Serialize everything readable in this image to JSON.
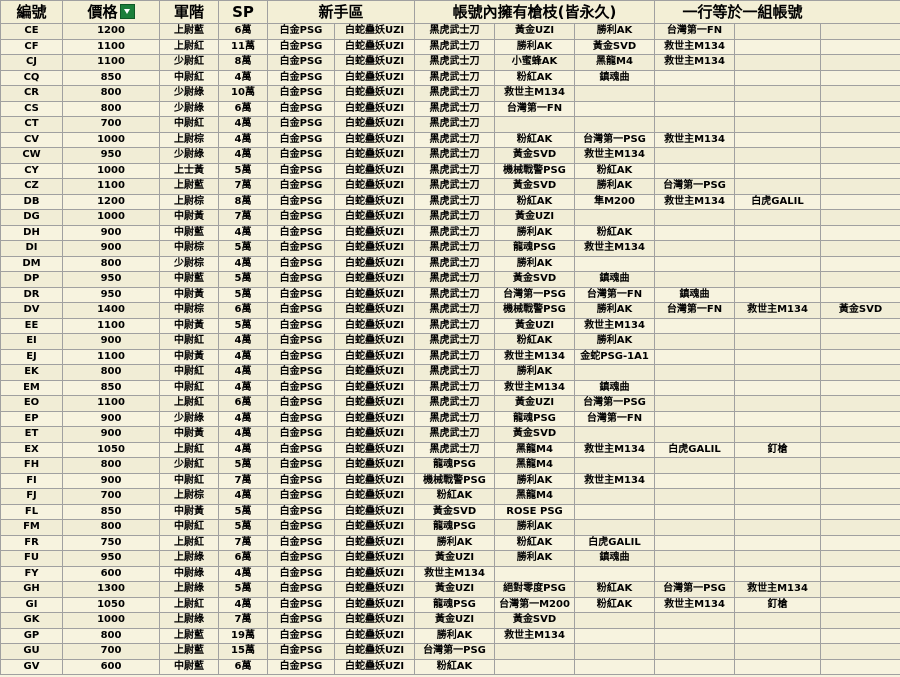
{
  "headers": {
    "code": "編號",
    "price": "價格",
    "rank": "軍階",
    "sp": "SP",
    "newbie": "新手區",
    "guns": "帳號內擁有槍枝(皆永久)",
    "note": "一行等於一組帳號"
  },
  "rows": [
    {
      "code": "CE",
      "price": "1200",
      "rank": "上尉藍",
      "sp": "6萬",
      "newbie": [
        "白金PSG",
        "白蛇蠱妖UZI"
      ],
      "guns": [
        "黑虎武士刀",
        "黃金UZI",
        "勝利AK",
        "台灣第一FN",
        "",
        "",
        ""
      ]
    },
    {
      "code": "CF",
      "price": "1100",
      "rank": "上尉紅",
      "sp": "11萬",
      "newbie": [
        "白金PSG",
        "白蛇蠱妖UZI"
      ],
      "guns": [
        "黑虎武士刀",
        "勝利AK",
        "黃金SVD",
        "救世主M134",
        "",
        "",
        ""
      ]
    },
    {
      "code": "CJ",
      "price": "1100",
      "rank": "少尉紅",
      "sp": "8萬",
      "newbie": [
        "白金PSG",
        "白蛇蠱妖UZI"
      ],
      "guns": [
        "黑虎武士刀",
        "小蜜蜂AK",
        "黑龍M4",
        "救世主M134",
        "",
        "",
        ""
      ]
    },
    {
      "code": "CQ",
      "price": "850",
      "rank": "中尉紅",
      "sp": "4萬",
      "newbie": [
        "白金PSG",
        "白蛇蠱妖UZI"
      ],
      "guns": [
        "黑虎武士刀",
        "粉紅AK",
        "鎮魂曲",
        "",
        "",
        "",
        ""
      ]
    },
    {
      "code": "CR",
      "price": "800",
      "rank": "少尉綠",
      "sp": "10萬",
      "newbie": [
        "白金PSG",
        "白蛇蠱妖UZI"
      ],
      "guns": [
        "黑虎武士刀",
        "救世主M134",
        "",
        "",
        "",
        "",
        ""
      ]
    },
    {
      "code": "CS",
      "price": "800",
      "rank": "少尉綠",
      "sp": "6萬",
      "newbie": [
        "白金PSG",
        "白蛇蠱妖UZI"
      ],
      "guns": [
        "黑虎武士刀",
        "台灣第一FN",
        "",
        "",
        "",
        "",
        ""
      ]
    },
    {
      "code": "CT",
      "price": "700",
      "rank": "中尉紅",
      "sp": "4萬",
      "newbie": [
        "白金PSG",
        "白蛇蠱妖UZI"
      ],
      "guns": [
        "黑虎武士刀",
        "",
        "",
        "",
        "",
        "",
        ""
      ]
    },
    {
      "code": "CV",
      "price": "1000",
      "rank": "上尉棕",
      "sp": "4萬",
      "newbie": [
        "白金PSG",
        "白蛇蠱妖UZI"
      ],
      "guns": [
        "黑虎武士刀",
        "粉紅AK",
        "台灣第一PSG",
        "救世主M134",
        "",
        "",
        ""
      ]
    },
    {
      "code": "CW",
      "price": "950",
      "rank": "少尉綠",
      "sp": "4萬",
      "newbie": [
        "白金PSG",
        "白蛇蠱妖UZI"
      ],
      "guns": [
        "黑虎武士刀",
        "黃金SVD",
        "救世主M134",
        "",
        "",
        "",
        ""
      ]
    },
    {
      "code": "CY",
      "price": "1000",
      "rank": "上士黃",
      "sp": "5萬",
      "newbie": [
        "白金PSG",
        "白蛇蠱妖UZI"
      ],
      "guns": [
        "黑虎武士刀",
        "機械戰警PSG",
        "粉紅AK",
        "",
        "",
        "",
        ""
      ]
    },
    {
      "code": "CZ",
      "price": "1100",
      "rank": "上尉藍",
      "sp": "7萬",
      "newbie": [
        "白金PSG",
        "白蛇蠱妖UZI"
      ],
      "guns": [
        "黑虎武士刀",
        "黃金SVD",
        "勝利AK",
        "台灣第一PSG",
        "",
        "",
        ""
      ]
    },
    {
      "code": "DB",
      "price": "1200",
      "rank": "上尉棕",
      "sp": "8萬",
      "newbie": [
        "白金PSG",
        "白蛇蠱妖UZI"
      ],
      "guns": [
        "黑虎武士刀",
        "粉紅AK",
        "隼M200",
        "救世主M134",
        "白虎GALIL",
        "",
        ""
      ]
    },
    {
      "code": "DG",
      "price": "1000",
      "rank": "中尉黃",
      "sp": "7萬",
      "newbie": [
        "白金PSG",
        "白蛇蠱妖UZI"
      ],
      "guns": [
        "黑虎武士刀",
        "黃金UZI",
        "",
        "",
        "",
        "",
        ""
      ]
    },
    {
      "code": "DH",
      "price": "900",
      "rank": "中尉藍",
      "sp": "4萬",
      "newbie": [
        "白金PSG",
        "白蛇蠱妖UZI"
      ],
      "guns": [
        "黑虎武士刀",
        "勝利AK",
        "粉紅AK",
        "",
        "",
        "",
        ""
      ]
    },
    {
      "code": "DI",
      "price": "900",
      "rank": "中尉棕",
      "sp": "5萬",
      "newbie": [
        "白金PSG",
        "白蛇蠱妖UZI"
      ],
      "guns": [
        "黑虎武士刀",
        "龍魂PSG",
        "救世主M134",
        "",
        "",
        "",
        ""
      ]
    },
    {
      "code": "DM",
      "price": "800",
      "rank": "少尉棕",
      "sp": "4萬",
      "newbie": [
        "白金PSG",
        "白蛇蠱妖UZI"
      ],
      "guns": [
        "黑虎武士刀",
        "勝利AK",
        "",
        "",
        "",
        "",
        ""
      ]
    },
    {
      "code": "DP",
      "price": "950",
      "rank": "中尉藍",
      "sp": "5萬",
      "newbie": [
        "白金PSG",
        "白蛇蠱妖UZI"
      ],
      "guns": [
        "黑虎武士刀",
        "黃金SVD",
        "鎮魂曲",
        "",
        "",
        "",
        ""
      ]
    },
    {
      "code": "DR",
      "price": "950",
      "rank": "中尉黃",
      "sp": "5萬",
      "newbie": [
        "白金PSG",
        "白蛇蠱妖UZI"
      ],
      "guns": [
        "黑虎武士刀",
        "台灣第一PSG",
        "台灣第一FN",
        "鎮魂曲",
        "",
        "",
        ""
      ]
    },
    {
      "code": "DV",
      "price": "1400",
      "rank": "中尉棕",
      "sp": "6萬",
      "newbie": [
        "白金PSG",
        "白蛇蠱妖UZI"
      ],
      "guns": [
        "黑虎武士刀",
        "機械戰警PSG",
        "勝利AK",
        "台灣第一FN",
        "救世主M134",
        "黃金SVD",
        ""
      ]
    },
    {
      "code": "EE",
      "price": "1100",
      "rank": "中尉黃",
      "sp": "5萬",
      "newbie": [
        "白金PSG",
        "白蛇蠱妖UZI"
      ],
      "guns": [
        "黑虎武士刀",
        "黃金UZI",
        "救世主M134",
        "",
        "",
        "",
        ""
      ]
    },
    {
      "code": "EI",
      "price": "900",
      "rank": "中尉紅",
      "sp": "4萬",
      "newbie": [
        "白金PSG",
        "白蛇蠱妖UZI"
      ],
      "guns": [
        "黑虎武士刀",
        "粉紅AK",
        "勝利AK",
        "",
        "",
        "",
        ""
      ]
    },
    {
      "code": "EJ",
      "price": "1100",
      "rank": "中尉黃",
      "sp": "4萬",
      "newbie": [
        "白金PSG",
        "白蛇蠱妖UZI"
      ],
      "guns": [
        "黑虎武士刀",
        "救世主M134",
        "金蛇PSG-1A1",
        "",
        "",
        "",
        ""
      ]
    },
    {
      "code": "EK",
      "price": "800",
      "rank": "中尉紅",
      "sp": "4萬",
      "newbie": [
        "白金PSG",
        "白蛇蠱妖UZI"
      ],
      "guns": [
        "黑虎武士刀",
        "勝利AK",
        "",
        "",
        "",
        "",
        ""
      ]
    },
    {
      "code": "EM",
      "price": "850",
      "rank": "中尉紅",
      "sp": "4萬",
      "newbie": [
        "白金PSG",
        "白蛇蠱妖UZI"
      ],
      "guns": [
        "黑虎武士刀",
        "救世主M134",
        "鎮魂曲",
        "",
        "",
        "",
        ""
      ]
    },
    {
      "code": "EO",
      "price": "1100",
      "rank": "上尉紅",
      "sp": "6萬",
      "newbie": [
        "白金PSG",
        "白蛇蠱妖UZI"
      ],
      "guns": [
        "黑虎武士刀",
        "黃金UZI",
        "台灣第一PSG",
        "",
        "",
        "",
        ""
      ]
    },
    {
      "code": "EP",
      "price": "900",
      "rank": "少尉綠",
      "sp": "4萬",
      "newbie": [
        "白金PSG",
        "白蛇蠱妖UZI"
      ],
      "guns": [
        "黑虎武士刀",
        "龍魂PSG",
        "台灣第一FN",
        "",
        "",
        "",
        ""
      ]
    },
    {
      "code": "ET",
      "price": "900",
      "rank": "中尉黃",
      "sp": "4萬",
      "newbie": [
        "白金PSG",
        "白蛇蠱妖UZI"
      ],
      "guns": [
        "黑虎武士刀",
        "黃金SVD",
        "",
        "",
        "",
        "",
        ""
      ]
    },
    {
      "code": "EX",
      "price": "1050",
      "rank": "上尉紅",
      "sp": "4萬",
      "newbie": [
        "白金PSG",
        "白蛇蠱妖UZI"
      ],
      "guns": [
        "黑虎武士刀",
        "黑龍M4",
        "救世主M134",
        "白虎GALIL",
        "釘槍",
        "",
        ""
      ]
    },
    {
      "code": "FH",
      "price": "800",
      "rank": "少尉紅",
      "sp": "5萬",
      "newbie": [
        "白金PSG",
        "白蛇蠱妖UZI"
      ],
      "guns": [
        "龍魂PSG",
        "黑龍M4",
        "",
        "",
        "",
        "",
        ""
      ]
    },
    {
      "code": "FI",
      "price": "900",
      "rank": "中尉紅",
      "sp": "7萬",
      "newbie": [
        "白金PSG",
        "白蛇蠱妖UZI"
      ],
      "guns": [
        "機械戰警PSG",
        "勝利AK",
        "救世主M134",
        "",
        "",
        "",
        ""
      ]
    },
    {
      "code": "FJ",
      "price": "700",
      "rank": "上尉棕",
      "sp": "4萬",
      "newbie": [
        "白金PSG",
        "白蛇蠱妖UZI"
      ],
      "guns": [
        "粉紅AK",
        "黑龍M4",
        "",
        "",
        "",
        "",
        ""
      ]
    },
    {
      "code": "FL",
      "price": "850",
      "rank": "中尉黃",
      "sp": "5萬",
      "newbie": [
        "白金PSG",
        "白蛇蠱妖UZI"
      ],
      "guns": [
        "黃金SVD",
        "ROSE PSG",
        "",
        "",
        "",
        "",
        ""
      ]
    },
    {
      "code": "FM",
      "price": "800",
      "rank": "中尉紅",
      "sp": "5萬",
      "newbie": [
        "白金PSG",
        "白蛇蠱妖UZI"
      ],
      "guns": [
        "龍魂PSG",
        "勝利AK",
        "",
        "",
        "",
        "",
        ""
      ]
    },
    {
      "code": "FR",
      "price": "750",
      "rank": "上尉紅",
      "sp": "7萬",
      "newbie": [
        "白金PSG",
        "白蛇蠱妖UZI"
      ],
      "guns": [
        "勝利AK",
        "粉紅AK",
        "白虎GALIL",
        "",
        "",
        "",
        ""
      ]
    },
    {
      "code": "FU",
      "price": "950",
      "rank": "上尉綠",
      "sp": "6萬",
      "newbie": [
        "白金PSG",
        "白蛇蠱妖UZI"
      ],
      "guns": [
        "黃金UZI",
        "勝利AK",
        "鎮魂曲",
        "",
        "",
        "",
        ""
      ]
    },
    {
      "code": "FY",
      "price": "600",
      "rank": "中尉綠",
      "sp": "4萬",
      "newbie": [
        "白金PSG",
        "白蛇蠱妖UZI"
      ],
      "guns": [
        "救世主M134",
        "",
        "",
        "",
        "",
        "",
        ""
      ]
    },
    {
      "code": "GH",
      "price": "1300",
      "rank": "上尉綠",
      "sp": "5萬",
      "newbie": [
        "白金PSG",
        "白蛇蠱妖UZI"
      ],
      "guns": [
        "黃金UZI",
        "絕對零度PSG",
        "粉紅AK",
        "台灣第一PSG",
        "救世主M134",
        "",
        ""
      ]
    },
    {
      "code": "GI",
      "price": "1050",
      "rank": "上尉紅",
      "sp": "4萬",
      "newbie": [
        "白金PSG",
        "白蛇蠱妖UZI"
      ],
      "guns": [
        "龍魂PSG",
        "台灣第一M200",
        "粉紅AK",
        "救世主M134",
        "釘槍",
        "",
        ""
      ]
    },
    {
      "code": "GK",
      "price": "1000",
      "rank": "上尉綠",
      "sp": "7萬",
      "newbie": [
        "白金PSG",
        "白蛇蠱妖UZI"
      ],
      "guns": [
        "黃金UZI",
        "黃金SVD",
        "",
        "",
        "",
        "",
        ""
      ]
    },
    {
      "code": "GP",
      "price": "800",
      "rank": "上尉藍",
      "sp": "19萬",
      "newbie": [
        "白金PSG",
        "白蛇蠱妖UZI"
      ],
      "guns": [
        "勝利AK",
        "救世主M134",
        "",
        "",
        "",
        "",
        ""
      ]
    },
    {
      "code": "GU",
      "price": "700",
      "rank": "上尉藍",
      "sp": "15萬",
      "newbie": [
        "白金PSG",
        "白蛇蠱妖UZI"
      ],
      "guns": [
        "台灣第一PSG",
        "",
        "",
        "",
        "",
        "",
        ""
      ]
    },
    {
      "code": "GV",
      "price": "600",
      "rank": "中尉藍",
      "sp": "6萬",
      "newbie": [
        "白金PSG",
        "白蛇蠱妖UZI"
      ],
      "guns": [
        "粉紅AK",
        "",
        "",
        "",
        "",
        "",
        ""
      ]
    }
  ]
}
